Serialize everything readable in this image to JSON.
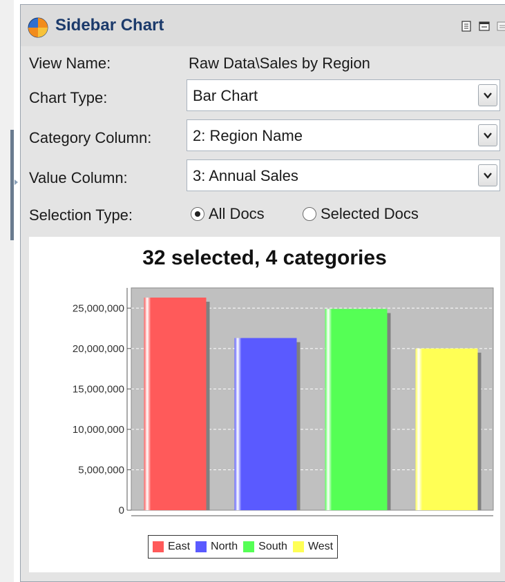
{
  "panel": {
    "title": "Sidebar Chart",
    "icons": [
      "document-icon",
      "window-icon",
      "minimize-icon"
    ]
  },
  "form": {
    "view_name_label": "View Name:",
    "view_name_value": "Raw Data\\Sales by Region",
    "chart_type_label": "Chart Type:",
    "chart_type_value": "Bar Chart",
    "category_label": "Category Column:",
    "category_value": "2: Region Name",
    "value_label": "Value Column:",
    "value_value": "3: Annual Sales",
    "selection_label": "Selection Type:",
    "selection_options": [
      "All Docs",
      "Selected Docs"
    ],
    "selection_selected": "All Docs"
  },
  "chart_data": {
    "type": "bar",
    "title": "32 selected, 4 categories",
    "categories": [
      "East",
      "North",
      "South",
      "West"
    ],
    "values": [
      26300000,
      21300000,
      24900000,
      20000000
    ],
    "colors": [
      "#ff5a5a",
      "#5a5aff",
      "#55ff55",
      "#ffff55"
    ],
    "ylim": [
      0,
      27500000
    ],
    "yticks": [
      0,
      5000000,
      10000000,
      15000000,
      20000000,
      25000000
    ],
    "ytick_labels": [
      "0",
      "5,000,000",
      "10,000,000",
      "15,000,000",
      "20,000,000",
      "25,000,000"
    ],
    "grid": true,
    "legend": "bottom-center"
  }
}
